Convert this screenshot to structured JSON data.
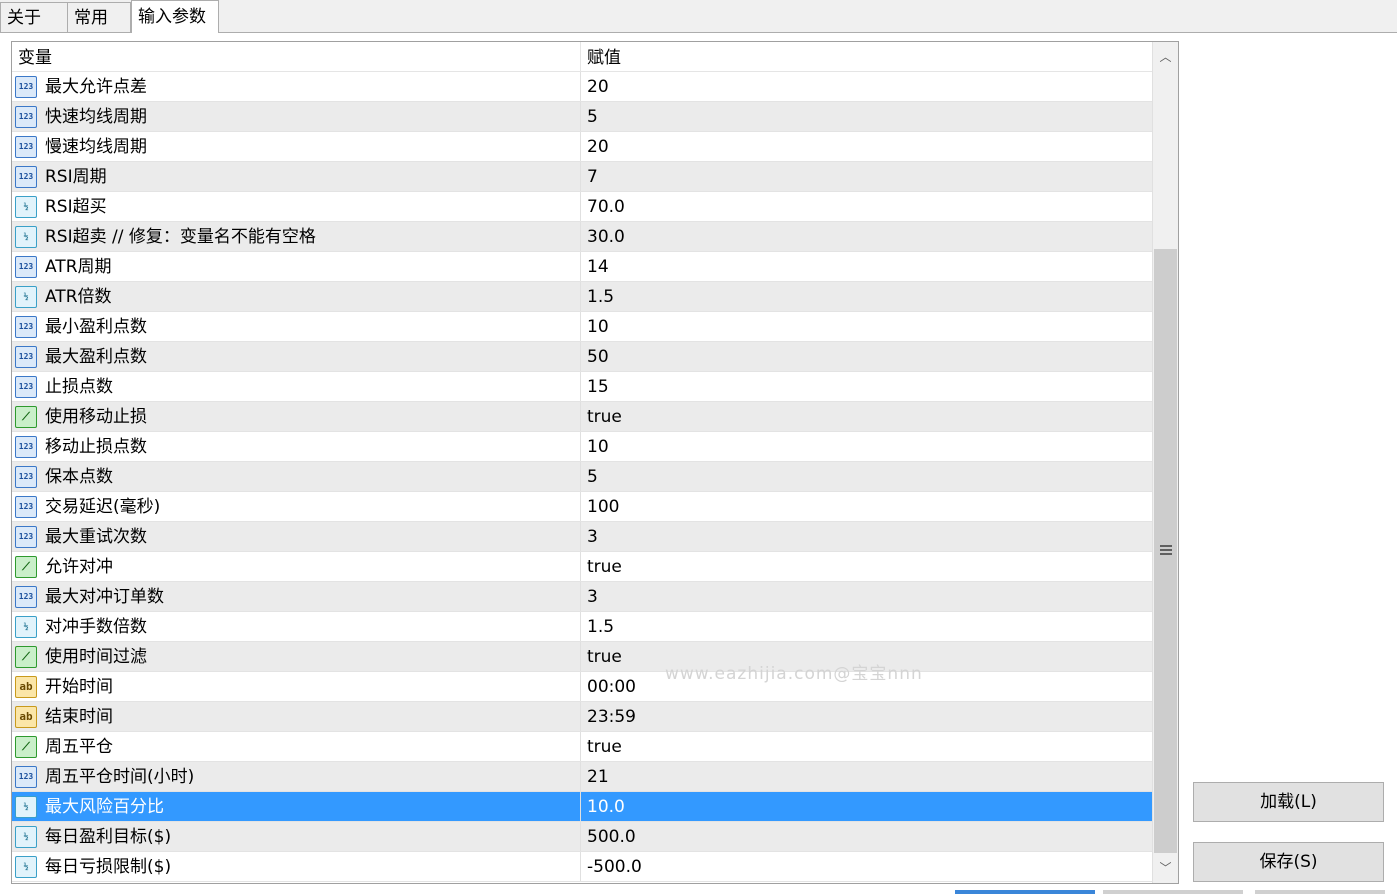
{
  "tabs": [
    {
      "label": "关于",
      "active": false
    },
    {
      "label": "常用",
      "active": false
    },
    {
      "label": "输入参数",
      "active": true
    }
  ],
  "grid": {
    "col_variable": "变量",
    "col_value": "赋值",
    "rows": [
      {
        "type": "int",
        "icon": "123",
        "name": "最大允许点差",
        "value": "20"
      },
      {
        "type": "int",
        "icon": "123",
        "name": "快速均线周期",
        "value": "5"
      },
      {
        "type": "int",
        "icon": "123",
        "name": "慢速均线周期",
        "value": "20"
      },
      {
        "type": "int",
        "icon": "123",
        "name": "RSI周期",
        "value": "7"
      },
      {
        "type": "double",
        "icon": "½",
        "name": "RSI超买",
        "value": "70.0"
      },
      {
        "type": "double",
        "icon": "½",
        "name": "RSI超卖  // 修复：变量名不能有空格",
        "value": "30.0"
      },
      {
        "type": "int",
        "icon": "123",
        "name": "ATR周期",
        "value": "14"
      },
      {
        "type": "double",
        "icon": "½",
        "name": "ATR倍数",
        "value": "1.5"
      },
      {
        "type": "int",
        "icon": "123",
        "name": "最小盈利点数",
        "value": "10"
      },
      {
        "type": "int",
        "icon": "123",
        "name": "最大盈利点数",
        "value": "50"
      },
      {
        "type": "int",
        "icon": "123",
        "name": "止损点数",
        "value": "15"
      },
      {
        "type": "bool",
        "icon": "⟋",
        "name": "使用移动止损",
        "value": "true"
      },
      {
        "type": "int",
        "icon": "123",
        "name": "移动止损点数",
        "value": "10"
      },
      {
        "type": "int",
        "icon": "123",
        "name": "保本点数",
        "value": "5"
      },
      {
        "type": "int",
        "icon": "123",
        "name": "交易延迟(毫秒)",
        "value": "100"
      },
      {
        "type": "int",
        "icon": "123",
        "name": "最大重试次数",
        "value": "3"
      },
      {
        "type": "bool",
        "icon": "⟋",
        "name": "允许对冲",
        "value": "true"
      },
      {
        "type": "int",
        "icon": "123",
        "name": "最大对冲订单数",
        "value": "3"
      },
      {
        "type": "double",
        "icon": "½",
        "name": "对冲手数倍数",
        "value": "1.5"
      },
      {
        "type": "bool",
        "icon": "⟋",
        "name": "使用时间过滤",
        "value": "true"
      },
      {
        "type": "string",
        "icon": "ab",
        "name": "开始时间",
        "value": "00:00"
      },
      {
        "type": "string",
        "icon": "ab",
        "name": "结束时间",
        "value": "23:59"
      },
      {
        "type": "bool",
        "icon": "⟋",
        "name": "周五平仓",
        "value": "true"
      },
      {
        "type": "int",
        "icon": "123",
        "name": "周五平仓时间(小时)",
        "value": "21"
      },
      {
        "type": "double",
        "icon": "½",
        "name": "最大风险百分比",
        "value": "10.0",
        "selected": true
      },
      {
        "type": "double",
        "icon": "½",
        "name": "每日盈利目标($)",
        "value": "500.0"
      },
      {
        "type": "double",
        "icon": "½",
        "name": "每日亏损限制($)",
        "value": "-500.0"
      }
    ]
  },
  "buttons": {
    "load": "加载(L)",
    "save": "保存(S)"
  },
  "watermark": "www.eazhijia.com@宝宝nnn",
  "colors": {
    "selection": "#3399ff",
    "row_alt": "#ebebeb"
  }
}
